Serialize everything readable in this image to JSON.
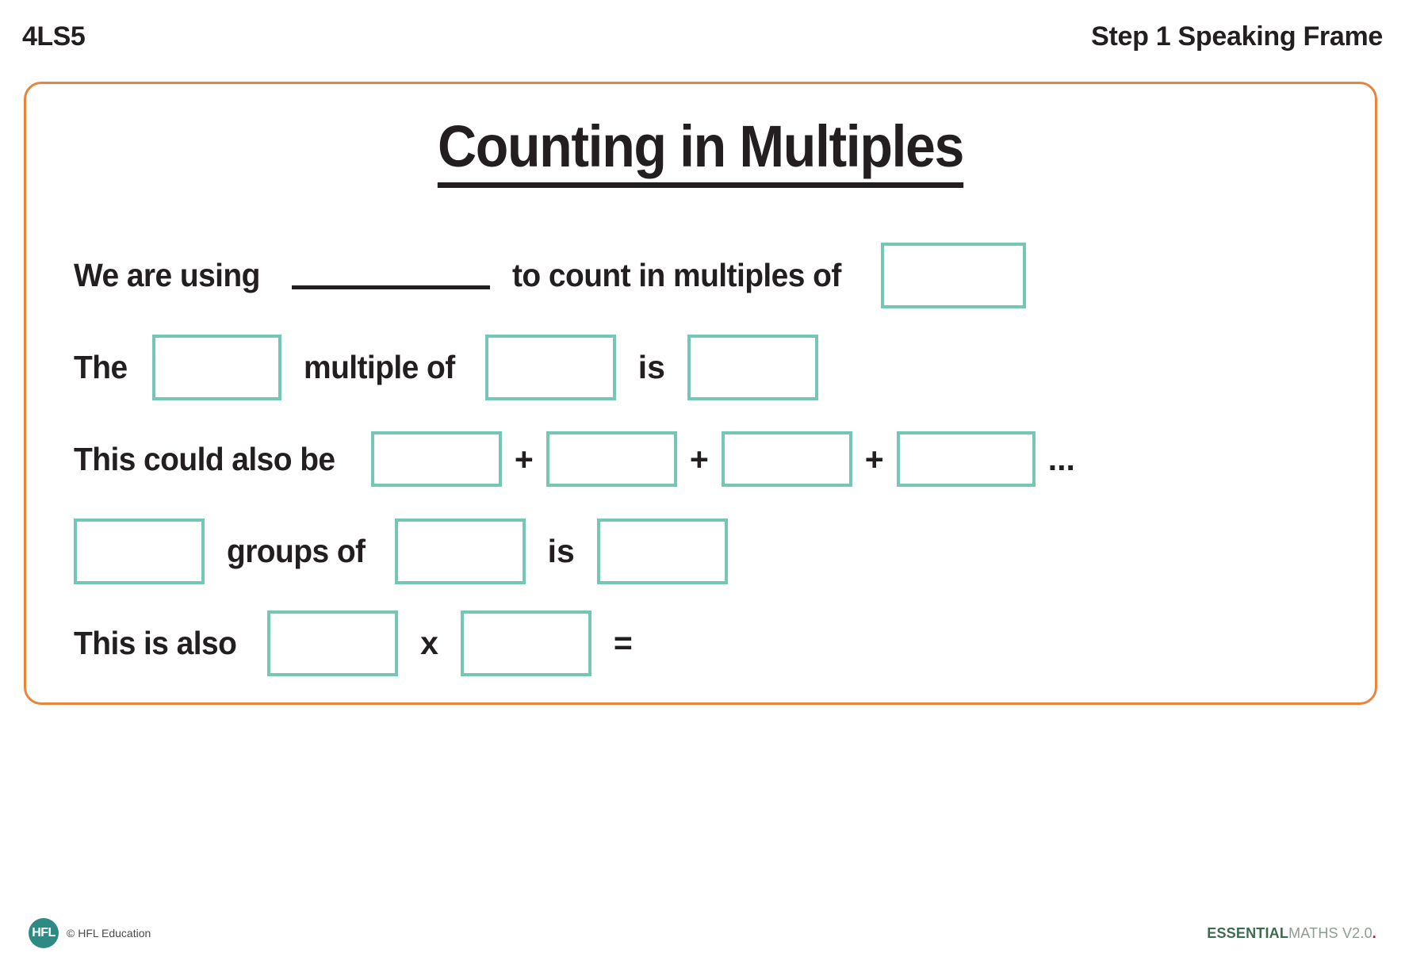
{
  "header": {
    "code": "4LS5",
    "step": "Step 1 Speaking Frame"
  },
  "card": {
    "title": "Counting in Multiples",
    "border_color": "#E8843C",
    "box_color": "#74C7B5"
  },
  "rows": [
    {
      "id": "row-we-are-using",
      "lead": "We are using",
      "mid": "to count in multiples of",
      "has_blank_line": true
    },
    {
      "id": "row-the-multiple-of",
      "lead": "The",
      "mid": "multiple of",
      "tail": "is"
    },
    {
      "id": "row-this-could-also-be",
      "lead": "This could also be",
      "plus": "+",
      "ellipsis": "..."
    },
    {
      "id": "row-groups-of",
      "mid": "groups of",
      "tail": "is"
    },
    {
      "id": "row-this-is-also",
      "lead": "This is also",
      "times": "x",
      "equals": "="
    }
  ],
  "footer": {
    "logo_text": "HFL",
    "copyright": "© HFL Education",
    "brand_bold": "ESSENTIAL",
    "brand_light": "MATHS V2.0",
    "brand_dot": "."
  }
}
